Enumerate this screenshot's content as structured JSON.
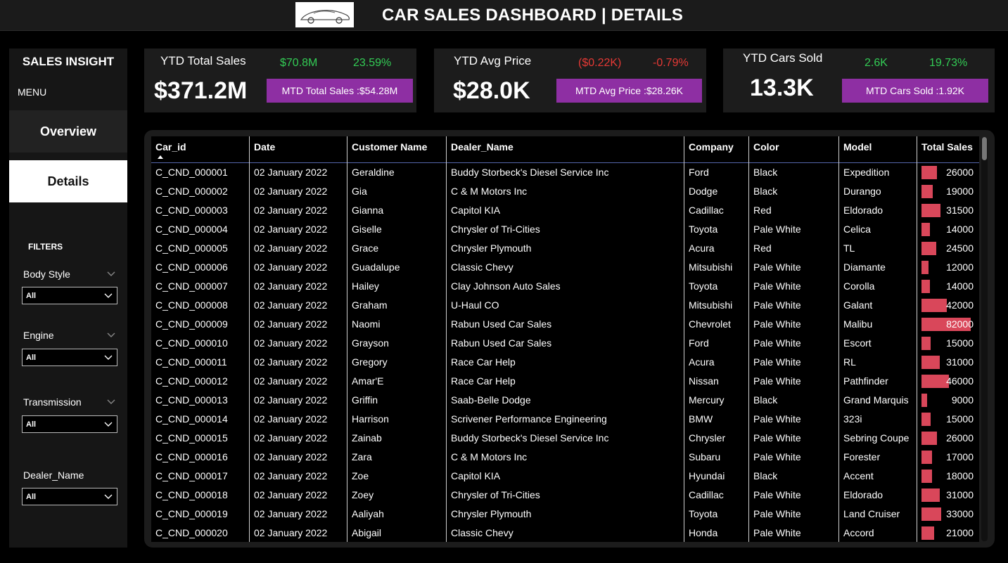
{
  "header": {
    "title": "CAR SALES DASHBOARD | DETAILS",
    "logo_icon": "sports-car-icon"
  },
  "sidebar": {
    "title": "SALES INSIGHT",
    "menu_label": "MENU",
    "nav": {
      "overview": "Overview",
      "details": "Details"
    },
    "filters_title": "FILTERS",
    "filters": [
      {
        "label": "Body Style",
        "value": "All"
      },
      {
        "label": "Engine",
        "value": "All"
      },
      {
        "label": "Transmission",
        "value": "All"
      },
      {
        "label": "Dealer_Name",
        "value": "All"
      }
    ]
  },
  "kpis": [
    {
      "title": "YTD Total Sales",
      "value": "$371.2M",
      "delta_abs": "$70.8M",
      "delta_pct": "23.59%",
      "mtd": "MTD Total Sales :$54.28M",
      "trend": "up"
    },
    {
      "title": "YTD Avg Price",
      "value": "$28.0K",
      "delta_abs": "($0.22K)",
      "delta_pct": "-0.79%",
      "mtd": "MTD Avg Price :$28.26K",
      "trend": "down"
    },
    {
      "title": "YTD Cars Sold",
      "value": "13.3K",
      "delta_abs": "2.6K",
      "delta_pct": "19.73%",
      "mtd": "MTD Cars Sold  :1.92K",
      "trend": "up"
    }
  ],
  "colors": {
    "accent": "#8e2fa3",
    "positive": "#33cc55",
    "negative": "#e53935",
    "bar": "#d9475a"
  },
  "table": {
    "columns": [
      "Car_id",
      "Date",
      "Customer Name",
      "Dealer_Name",
      "Company",
      "Color",
      "Model",
      "Total Sales"
    ],
    "sales_max": 82000,
    "rows": [
      [
        "C_CND_000001",
        "02 January 2022",
        "Geraldine",
        "Buddy Storbeck's Diesel Service Inc",
        "Ford",
        "Black",
        "Expedition",
        26000
      ],
      [
        "C_CND_000002",
        "02 January 2022",
        "Gia",
        "C & M Motors Inc",
        "Dodge",
        "Black",
        "Durango",
        19000
      ],
      [
        "C_CND_000003",
        "02 January 2022",
        "Gianna",
        "Capitol KIA",
        "Cadillac",
        "Red",
        "Eldorado",
        31500
      ],
      [
        "C_CND_000004",
        "02 January 2022",
        "Giselle",
        "Chrysler of Tri-Cities",
        "Toyota",
        "Pale White",
        "Celica",
        14000
      ],
      [
        "C_CND_000005",
        "02 January 2022",
        "Grace",
        "Chrysler Plymouth",
        "Acura",
        "Red",
        "TL",
        24500
      ],
      [
        "C_CND_000006",
        "02 January 2022",
        "Guadalupe",
        "Classic Chevy",
        "Mitsubishi",
        "Pale White",
        "Diamante",
        12000
      ],
      [
        "C_CND_000007",
        "02 January 2022",
        "Hailey",
        "Clay Johnson Auto Sales",
        "Toyota",
        "Pale White",
        "Corolla",
        14000
      ],
      [
        "C_CND_000008",
        "02 January 2022",
        "Graham",
        "U-Haul CO",
        "Mitsubishi",
        "Pale White",
        "Galant",
        42000
      ],
      [
        "C_CND_000009",
        "02 January 2022",
        "Naomi",
        "Rabun Used Car Sales",
        "Chevrolet",
        "Pale White",
        "Malibu",
        82000
      ],
      [
        "C_CND_000010",
        "02 January 2022",
        "Grayson",
        "Rabun Used Car Sales",
        "Ford",
        "Pale White",
        "Escort",
        15000
      ],
      [
        "C_CND_000011",
        "02 January 2022",
        "Gregory",
        "Race Car Help",
        "Acura",
        "Pale White",
        "RL",
        31000
      ],
      [
        "C_CND_000012",
        "02 January 2022",
        "Amar'E",
        "Race Car Help",
        "Nissan",
        "Pale White",
        "Pathfinder",
        46000
      ],
      [
        "C_CND_000013",
        "02 January 2022",
        "Griffin",
        "Saab-Belle Dodge",
        "Mercury",
        "Black",
        "Grand Marquis",
        9000
      ],
      [
        "C_CND_000014",
        "02 January 2022",
        "Harrison",
        "Scrivener Performance Engineering",
        "BMW",
        "Pale White",
        "323i",
        15000
      ],
      [
        "C_CND_000015",
        "02 January 2022",
        "Zainab",
        "Buddy Storbeck's Diesel Service Inc",
        "Chrysler",
        "Pale White",
        "Sebring Coupe",
        26000
      ],
      [
        "C_CND_000016",
        "02 January 2022",
        "Zara",
        "C & M Motors Inc",
        "Subaru",
        "Pale White",
        "Forester",
        17000
      ],
      [
        "C_CND_000017",
        "02 January 2022",
        "Zoe",
        "Capitol KIA",
        "Hyundai",
        "Black",
        "Accent",
        18000
      ],
      [
        "C_CND_000018",
        "02 January 2022",
        "Zoey",
        "Chrysler of Tri-Cities",
        "Cadillac",
        "Pale White",
        "Eldorado",
        31000
      ],
      [
        "C_CND_000019",
        "02 January 2022",
        "Aaliyah",
        "Chrysler Plymouth",
        "Toyota",
        "Pale White",
        "Land Cruiser",
        33000
      ],
      [
        "C_CND_000020",
        "02 January 2022",
        "Abigail",
        "Classic Chevy",
        "Honda",
        "Pale White",
        "Accord",
        21000
      ]
    ]
  }
}
